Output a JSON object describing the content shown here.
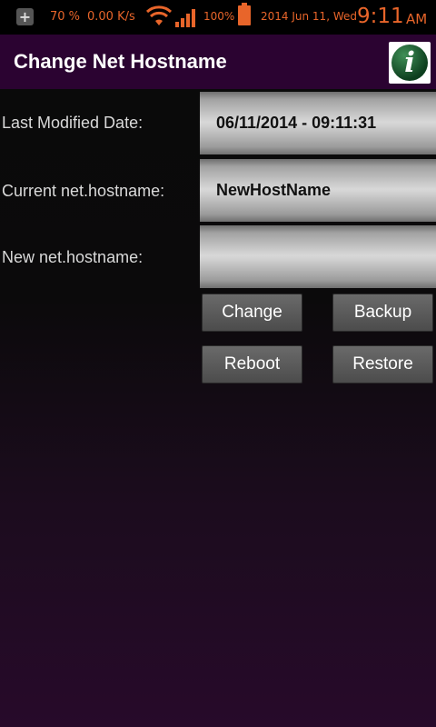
{
  "status_bar": {
    "battery_percent_small": "70 %",
    "net_speed": "0.00 K/s",
    "battery_text": "100%",
    "date": "2014 Jun 11, Wed",
    "time": "9:11",
    "ampm": "AM",
    "accent_color": "#e8652a",
    "icons": [
      "notification-plus-icon",
      "wifi-icon",
      "signal-icon",
      "battery-icon"
    ]
  },
  "action_bar": {
    "title": "Change Net Hostname",
    "info_icon_letter": "i",
    "background_color": "#2b0331"
  },
  "form": {
    "last_modified_label": "Last Modified Date:",
    "last_modified_value": "06/11/2014  -  09:11:31",
    "current_label": "Current net.hostname:",
    "current_value": "NewHostName",
    "new_label": "New net.hostname:",
    "new_value": ""
  },
  "buttons": {
    "change": "Change",
    "backup": "Backup",
    "reboot": "Reboot",
    "restore": "Restore"
  }
}
